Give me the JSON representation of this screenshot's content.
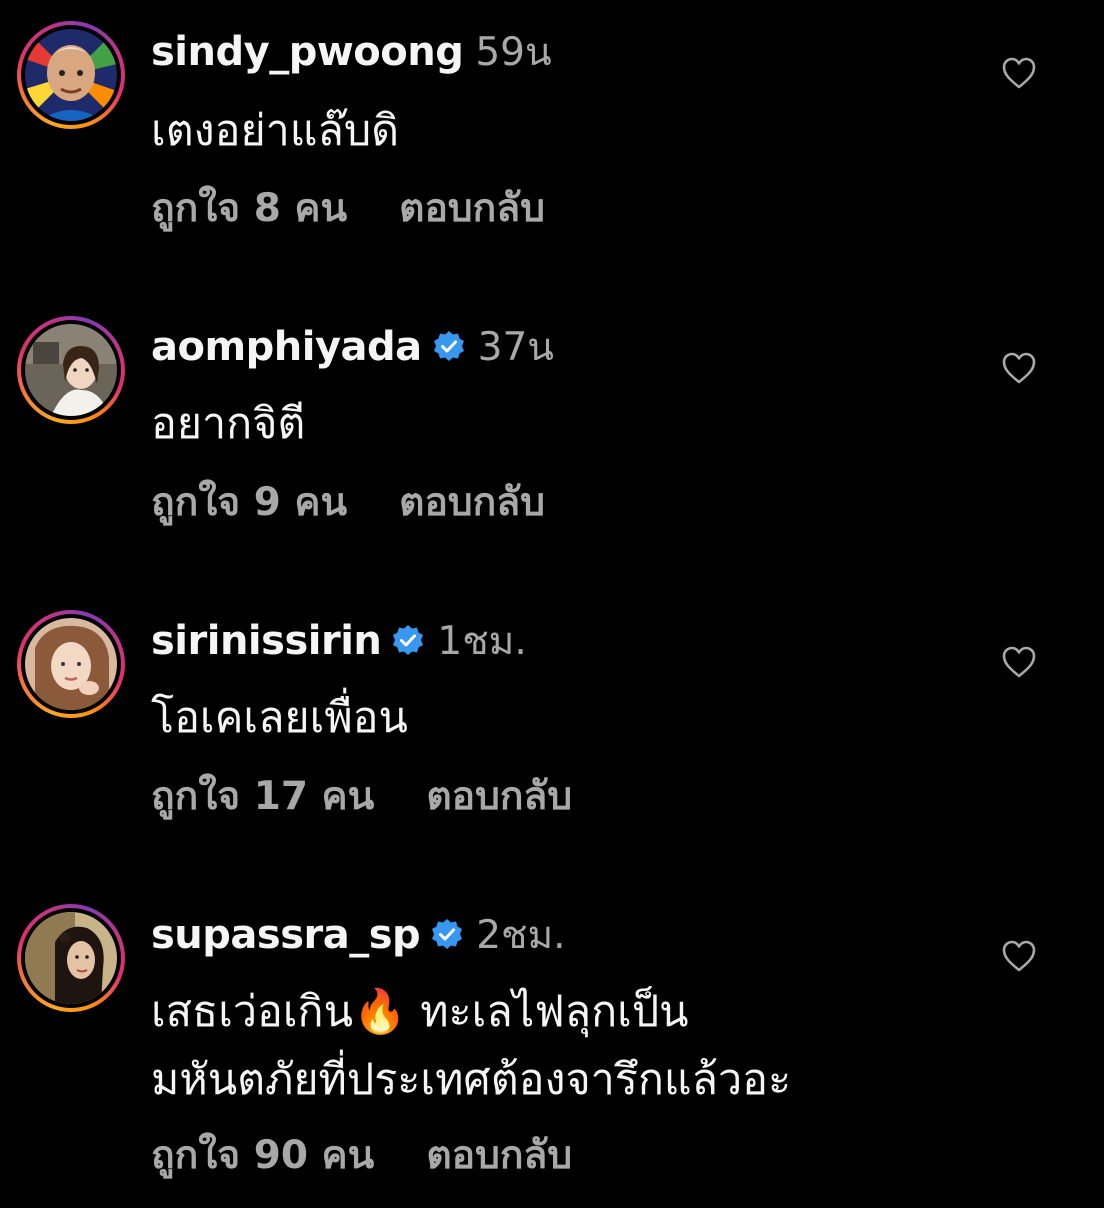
{
  "comments": [
    {
      "username": "sindy_pwoong",
      "verified": false,
      "time": "59น",
      "lines": [
        "เตงอย่าแล๊บดิ"
      ],
      "likes": "ถูกใจ 8 คน",
      "reply": "ตอบกลับ",
      "avatar_icon": "avatar-person-colorful"
    },
    {
      "username": "aomphiyada",
      "verified": true,
      "time": "37น",
      "lines": [
        "อยากจิตี"
      ],
      "likes": "ถูกใจ 9 คน",
      "reply": "ตอบกลับ",
      "avatar_icon": "avatar-person-room"
    },
    {
      "username": "sirinissirin",
      "verified": true,
      "time": "1ชม.",
      "lines": [
        "โอเคเลยเพื่อน"
      ],
      "likes": "ถูกใจ 17 คน",
      "reply": "ตอบกลับ",
      "avatar_icon": "avatar-person-portrait"
    },
    {
      "username": "supassra_sp",
      "verified": true,
      "time": "2ชม.",
      "lines": [
        "เสธเว่อเกิน🔥 ทะเลไฟลุกเป็น",
        "มหันตภัยที่ประเทศต้องจารึกแล้วอะ"
      ],
      "likes": "ถูกใจ 90 คน",
      "reply": "ตอบกลับ",
      "avatar_icon": "avatar-person-dark"
    }
  ],
  "colors": {
    "background": "#000000",
    "text": "#f5f5f5",
    "muted": "#a8a8a8",
    "verified": "#3897f0"
  },
  "icons": {
    "like": "heart-outline-icon",
    "verified": "verified-badge-icon",
    "emoji": "fire-emoji"
  }
}
